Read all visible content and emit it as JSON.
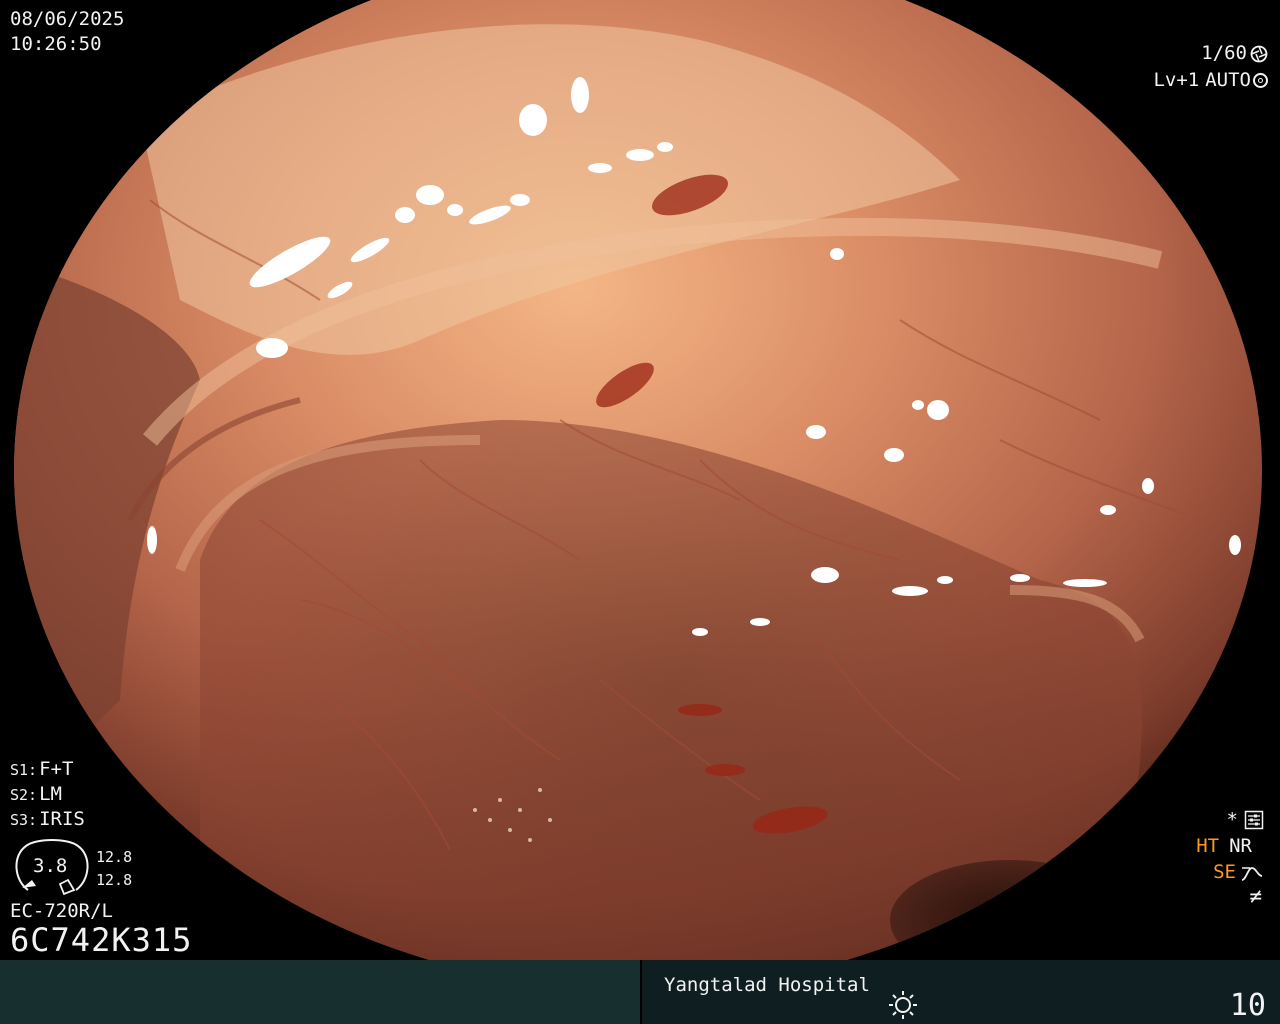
{
  "overlay": {
    "date": "08/06/2025",
    "time": "10:26:50",
    "shutter": "1/60",
    "shutter_icon": "aperture-icon",
    "level": "Lv+1",
    "auto": "AUTO",
    "auto_icon": "iris-icon"
  },
  "settings": [
    {
      "key": "S1:",
      "value": "F+T"
    },
    {
      "key": "S2:",
      "value": "LM"
    },
    {
      "key": "S3:",
      "value": "IRIS"
    }
  ],
  "gauge": {
    "value": "3.8",
    "upper": "12.8",
    "lower": "12.8"
  },
  "scope": {
    "model": "EC-720R/L",
    "serial": "6C742K315"
  },
  "right_status": {
    "star": "*",
    "star_icon": "settings-panel-icon",
    "ht": "HT",
    "nr": "NR",
    "se": "SE",
    "se_icon": "curve-icon",
    "noflash": "≠",
    "accent_color": "#ff9a1a"
  },
  "bottom_bar": {
    "hospital": "Yangtalad Hospital",
    "brightness_icon": "brightness-icon",
    "counter": "10"
  }
}
